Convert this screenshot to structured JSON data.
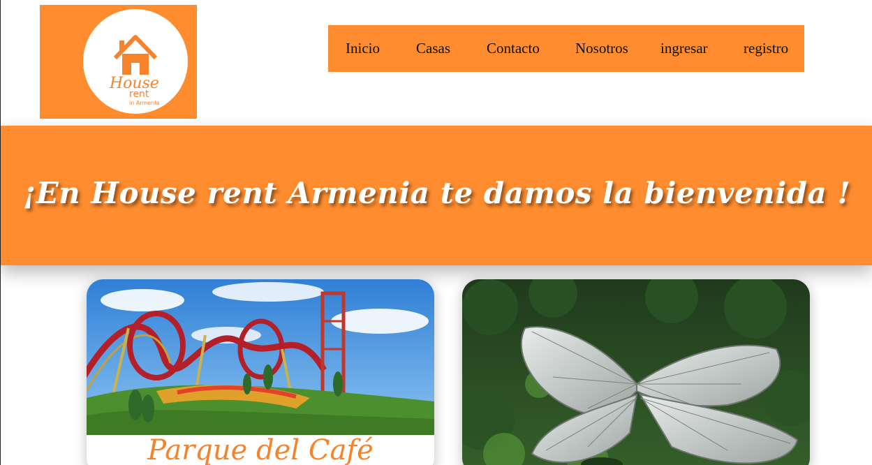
{
  "brand": {
    "logo_house": "House",
    "logo_rent": "rent",
    "logo_place": "in Armenia",
    "logo_color": "#ff8c2e"
  },
  "nav": {
    "items": [
      {
        "label": "Inicio"
      },
      {
        "label": "Casas"
      },
      {
        "label": "Contacto"
      },
      {
        "label": "Nosotros"
      },
      {
        "label": "ingresar"
      },
      {
        "label": "registro"
      }
    ]
  },
  "hero": {
    "title": "¡En House rent Armenia te damos la bienvenida !"
  },
  "cards": [
    {
      "caption": "Parque del Café",
      "image": "roller-coaster-photo"
    },
    {
      "caption": "",
      "image": "butterfly-greenhouse-photo"
    }
  ]
}
